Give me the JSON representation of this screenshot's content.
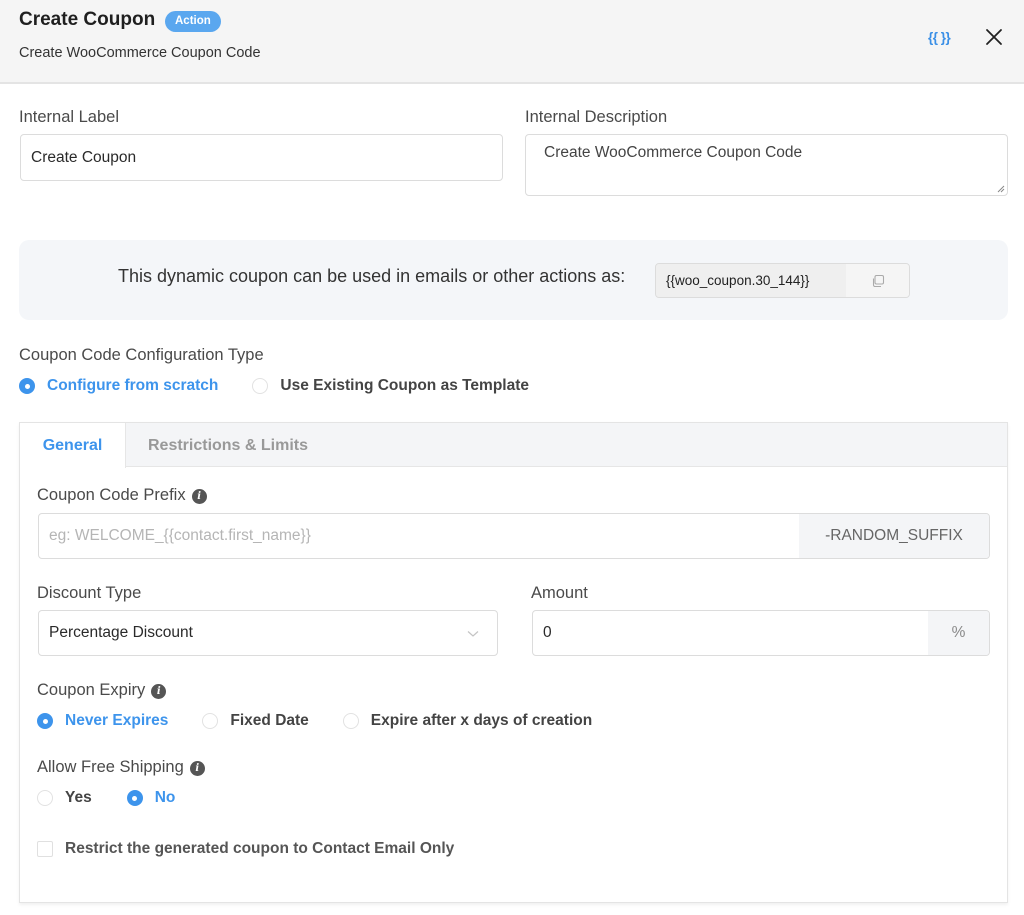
{
  "header": {
    "title": "Create Coupon",
    "badge": "Action",
    "subtitle": "Create WooCommerce Coupon Code",
    "smartcode_icon": "{{ }}",
    "close_icon": "close-icon"
  },
  "internal_label": {
    "label": "Internal Label",
    "value": "Create Coupon"
  },
  "internal_description": {
    "label": "Internal Description",
    "value": "Create WooCommerce Coupon Code"
  },
  "dynamic_coupon": {
    "text": "This dynamic coupon can be used in emails or other actions as:",
    "code": "{{woo_coupon.30_144}}",
    "copy_icon": "copy-icon"
  },
  "config_type": {
    "label": "Coupon Code Configuration Type",
    "options": [
      {
        "label": "Configure from scratch",
        "checked": true
      },
      {
        "label": "Use Existing Coupon as Template",
        "checked": false
      }
    ]
  },
  "tabs": [
    {
      "label": "General",
      "active": true
    },
    {
      "label": "Restrictions & Limits",
      "active": false
    }
  ],
  "general": {
    "prefix": {
      "label": "Coupon Code Prefix",
      "placeholder": "eg: WELCOME_{{contact.first_name}}",
      "value": "",
      "suffix": "-RANDOM_SUFFIX"
    },
    "discount_type": {
      "label": "Discount Type",
      "selected": "Percentage Discount"
    },
    "amount": {
      "label": "Amount",
      "value": "0",
      "unit": "%"
    },
    "expiry": {
      "label": "Coupon Expiry",
      "options": [
        {
          "label": "Never Expires",
          "checked": true
        },
        {
          "label": "Fixed Date",
          "checked": false
        },
        {
          "label": "Expire after x days of creation",
          "checked": false
        }
      ]
    },
    "free_shipping": {
      "label": "Allow Free Shipping",
      "options": [
        {
          "label": "Yes",
          "checked": false
        },
        {
          "label": "No",
          "checked": true
        }
      ]
    },
    "restrict_email": {
      "label": "Restrict the generated coupon to Contact Email Only",
      "checked": false
    }
  },
  "colors": {
    "accent": "#3d94ec",
    "badge": "#5aa7ef"
  }
}
